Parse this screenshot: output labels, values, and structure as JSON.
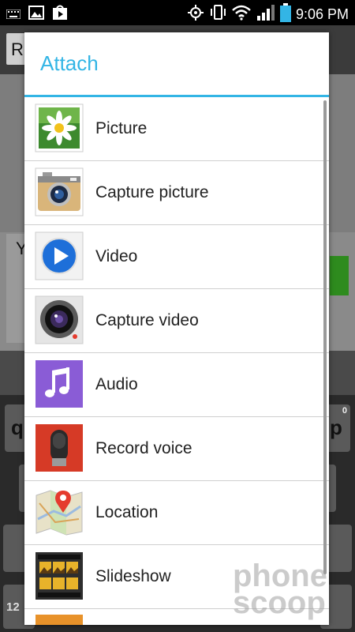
{
  "status_bar": {
    "time": "9:06 PM",
    "icons": [
      "keyboard-icon",
      "image-icon",
      "play-store-icon",
      "gps-icon",
      "vibrate-icon",
      "wifi-icon",
      "signal-icon",
      "battery-icon"
    ]
  },
  "background": {
    "top_initial": "R",
    "compose_initial": "Y",
    "key_left": "q",
    "key_right": "p",
    "key_right_sup": "0",
    "key_bottom_left": "12"
  },
  "dialog": {
    "title": "Attach",
    "accent_color": "#33b5e5",
    "items": [
      {
        "label": "Picture",
        "icon": "picture-daisy-icon"
      },
      {
        "label": "Capture picture",
        "icon": "camera-icon"
      },
      {
        "label": "Video",
        "icon": "video-play-icon"
      },
      {
        "label": "Capture video",
        "icon": "video-camera-icon"
      },
      {
        "label": "Audio",
        "icon": "music-note-icon"
      },
      {
        "label": "Record voice",
        "icon": "microphone-icon"
      },
      {
        "label": "Location",
        "icon": "map-pin-icon"
      },
      {
        "label": "Slideshow",
        "icon": "slideshow-icon"
      }
    ]
  },
  "watermark": {
    "line1": "phone",
    "line2": "scoop"
  }
}
